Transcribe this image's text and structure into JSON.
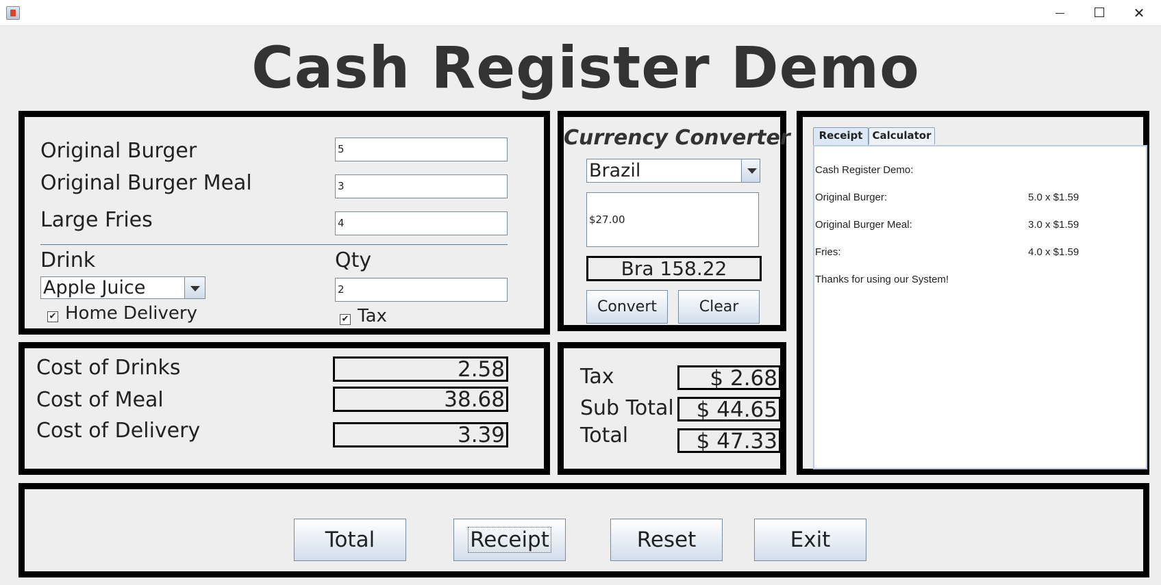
{
  "window": {
    "minimize": "—",
    "close": "✕"
  },
  "title": "Cash Register Demo",
  "order": {
    "items": [
      {
        "label": "Original Burger",
        "qty": "5"
      },
      {
        "label": "Original Burger Meal",
        "qty": "3"
      },
      {
        "label": "Large Fries",
        "qty": "4"
      }
    ],
    "drink_label": "Drink",
    "qty_label": "Qty",
    "drink_selected": "Apple Juice",
    "drink_qty": "2",
    "home_delivery_label": "Home Delivery",
    "home_delivery_checked": true,
    "tax_label": "Tax",
    "tax_checked": true,
    "check_mark": "✔"
  },
  "costs": [
    {
      "label": "Cost of Drinks",
      "value": "2.58"
    },
    {
      "label": "Cost of Meal",
      "value": "38.68"
    },
    {
      "label": "Cost of Delivery",
      "value": "3.39"
    }
  ],
  "converter": {
    "title": "Currency Converter",
    "country": "Brazil",
    "amount": "$27.00",
    "result": "Bra 158.22",
    "convert_label": "Convert",
    "clear_label": "Clear"
  },
  "totals": [
    {
      "label": "Tax",
      "value": "$ 2.68"
    },
    {
      "label": "Sub Total",
      "value": "$ 44.65"
    },
    {
      "label": "Total",
      "value": "$ 47.33"
    }
  ],
  "tabs": {
    "receipt": "Receipt",
    "calculator": "Calculator",
    "active": "Receipt"
  },
  "receipt": {
    "header": "Cash Register Demo:",
    "lines": [
      {
        "item": "Original Burger:",
        "detail": "5.0 x $1.59"
      },
      {
        "item": "Original Burger Meal:",
        "detail": "3.0 x $1.59"
      },
      {
        "item": "Fries:",
        "detail": "4.0 x $1.59"
      }
    ],
    "footer": "Thanks for using our System!"
  },
  "actions": {
    "total": "Total",
    "receipt": "Receipt",
    "reset": "Reset",
    "exit": "Exit"
  }
}
